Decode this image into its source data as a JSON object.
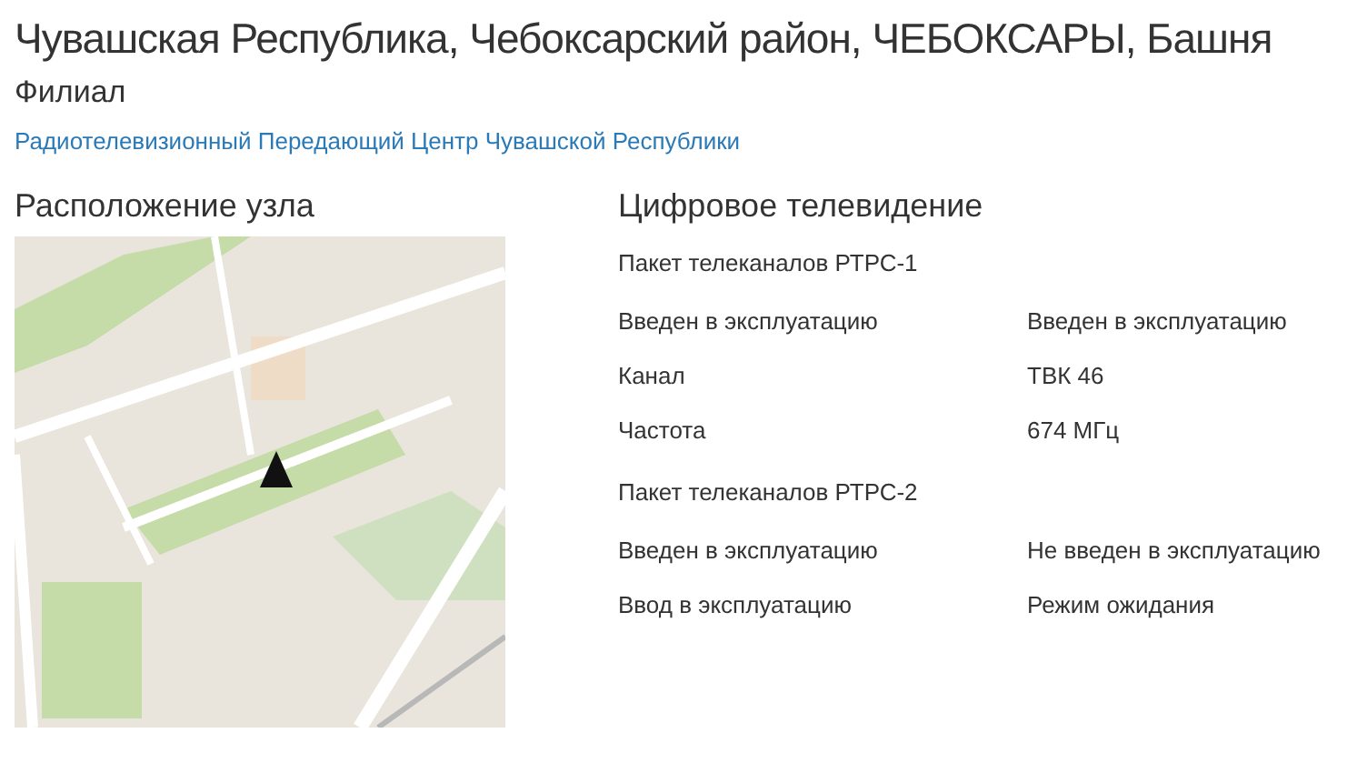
{
  "page": {
    "title": "Чувашская Республика, Чебоксарский район, ЧЕБОКСАРЫ, Башня",
    "subtitle": "Филиал",
    "link": "Радиотелевизионный Передающий Центр Чувашской Республики"
  },
  "location": {
    "heading": "Расположение узла"
  },
  "digital_tv": {
    "heading": "Цифровое телевидение",
    "packages": [
      {
        "name": "Пакет телеканалов РТРС-1",
        "rows": [
          {
            "label": "Введен в эксплуатацию",
            "value": "Введен в эксплуатацию"
          },
          {
            "label": "Канал",
            "value": "ТВК 46"
          },
          {
            "label": "Частота",
            "value": "674 МГц"
          }
        ]
      },
      {
        "name": "Пакет телеканалов РТРС-2",
        "rows": [
          {
            "label": "Введен в эксплуатацию",
            "value": "Не введен в эксплуатацию"
          },
          {
            "label": "Ввод в эксплуатацию",
            "value": "Режим ожидания"
          }
        ]
      }
    ]
  }
}
